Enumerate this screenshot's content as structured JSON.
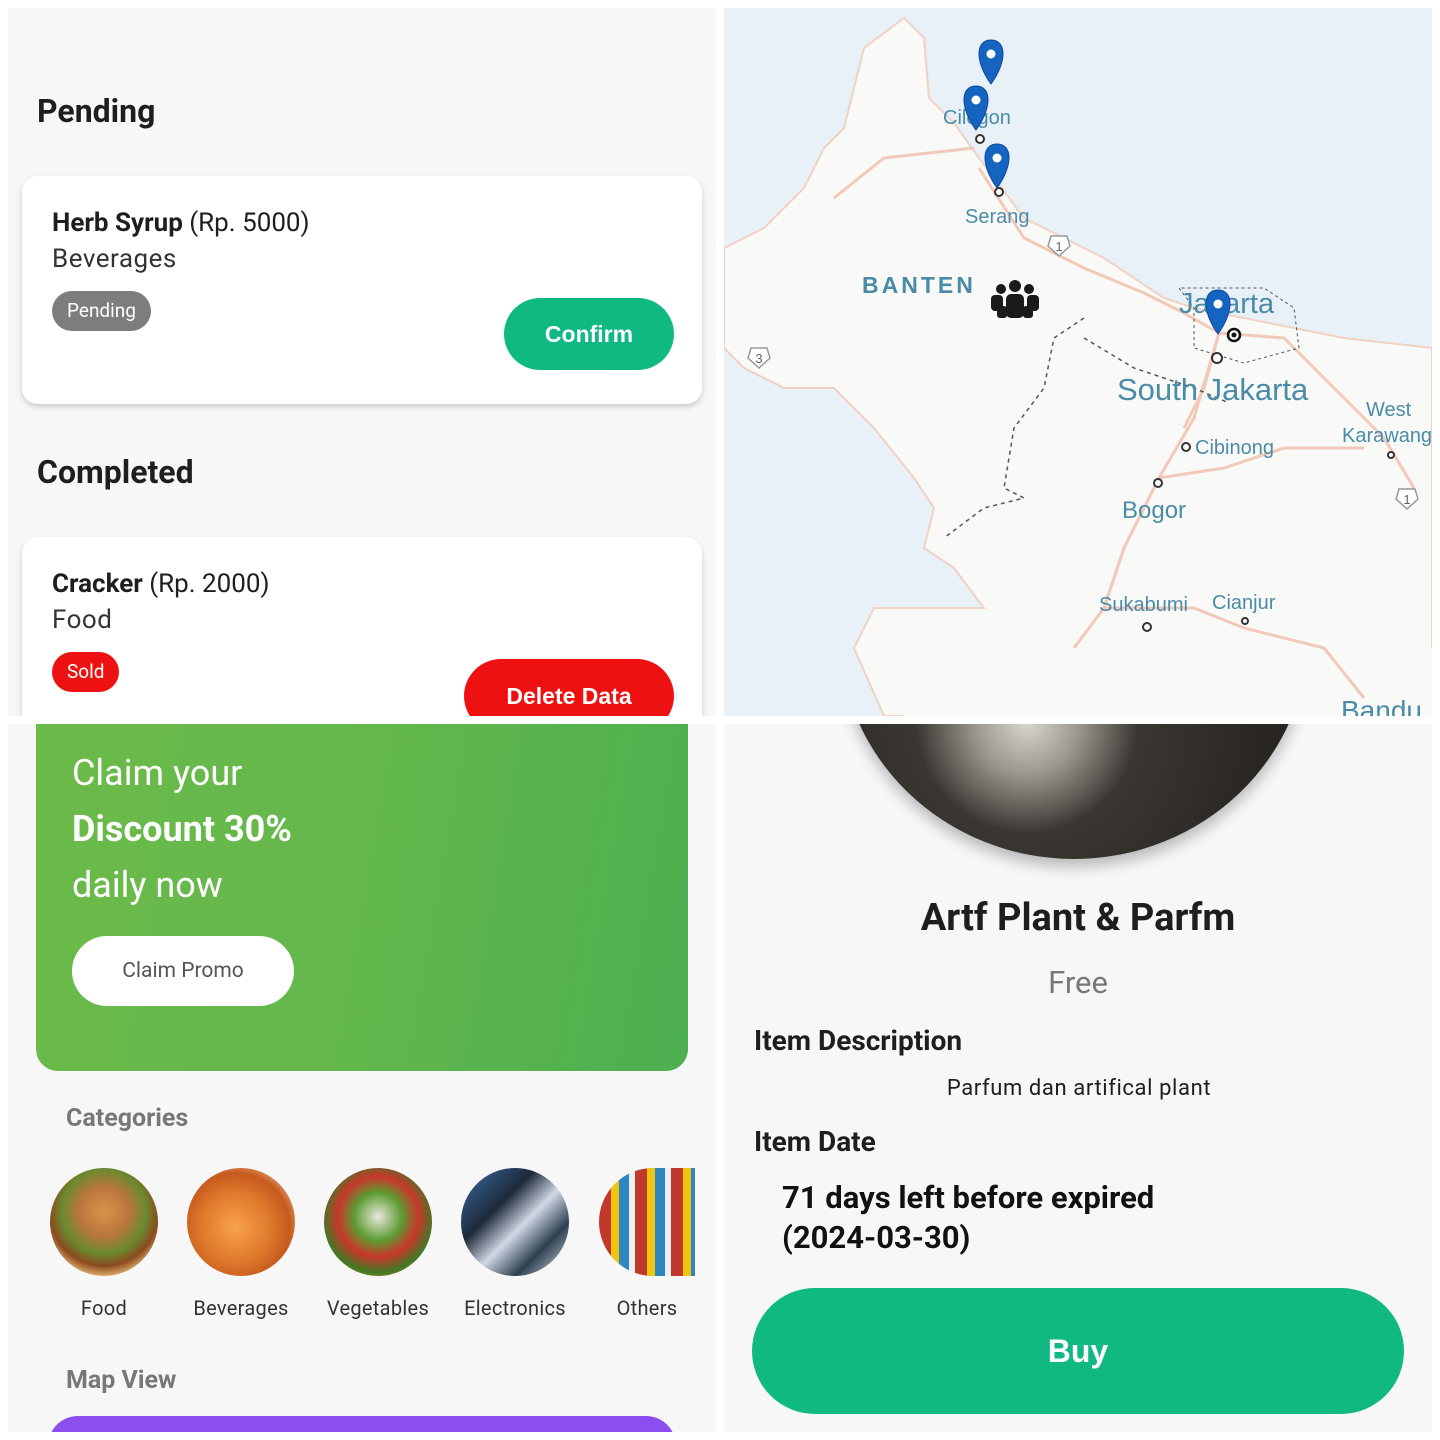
{
  "orders": {
    "pending_title": "Pending",
    "pending_item": {
      "name": "Herb Syrup",
      "price": "(Rp. 5000)",
      "category": "Beverages",
      "status": "Pending",
      "action": "Confirm"
    },
    "completed_title": "Completed",
    "completed_item": {
      "name": "Cracker",
      "price": "(Rp. 2000)",
      "category": "Food",
      "status": "Sold",
      "action": "Delete Data"
    }
  },
  "map": {
    "labels": {
      "cilegon": "Cilegon",
      "serang": "Serang",
      "banten": "BANTEN",
      "jakarta": "Jakarta",
      "south_jakarta": "South Jakarta",
      "west_karawang_1": "West",
      "west_karawang_2": "Karawang",
      "cibinong": "Cibinong",
      "bogor": "Bogor",
      "sukabumi": "Sukabumi",
      "cianjur": "Cianjur",
      "bandung": "Bandu"
    },
    "road_shields": {
      "r1a": "1",
      "r3": "3",
      "r1b": "1"
    },
    "colors": {
      "water": "#e8f0f8",
      "land": "#f9f9f7",
      "road": "#f2c9b8",
      "label": "#4a8ca8",
      "pin": "#1565c0"
    }
  },
  "home": {
    "promo_line1": "Claim your",
    "promo_line2": "Discount 30%",
    "promo_line3": "daily now",
    "promo_button": "Claim Promo",
    "categories_title": "Categories",
    "categories": [
      "Food",
      "Beverages",
      "Vegetables",
      "Electronics",
      "Others"
    ],
    "map_view_title": "Map View"
  },
  "detail": {
    "title": "Artf Plant & Parfm",
    "price": "Free",
    "desc_label": "Item Description",
    "desc_text": "Parfum dan artifical plant",
    "date_label": "Item Date",
    "expiry_line1": "71 days left before expired",
    "expiry_line2": "(2024-03-30)",
    "buy_button": "Buy",
    "accent": "#10b981"
  }
}
